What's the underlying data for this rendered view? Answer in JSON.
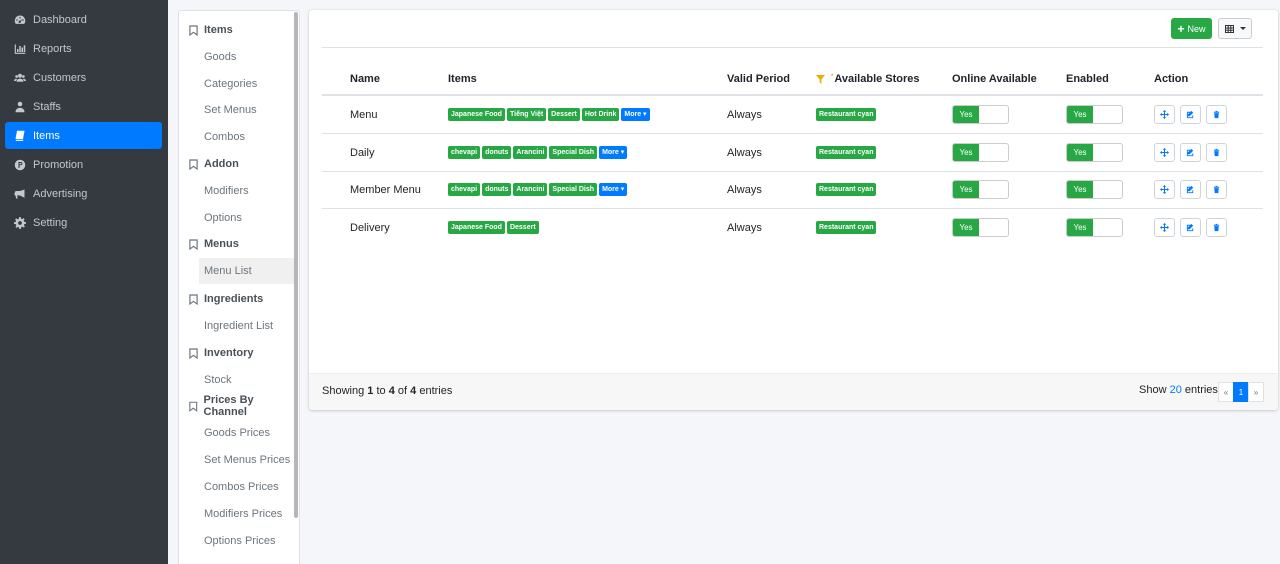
{
  "sidebar": {
    "items": [
      {
        "label": "Dashboard",
        "icon": "tachometer-icon"
      },
      {
        "label": "Reports",
        "icon": "bar-chart-icon"
      },
      {
        "label": "Customers",
        "icon": "users-icon"
      },
      {
        "label": "Staffs",
        "icon": "user-tie-icon"
      },
      {
        "label": "Items",
        "icon": "book-icon",
        "active": true
      },
      {
        "label": "Promotion",
        "icon": "product-hunt-icon"
      },
      {
        "label": "Advertising",
        "icon": "bullhorn-icon"
      },
      {
        "label": "Setting",
        "icon": "gear-icon"
      }
    ]
  },
  "subnav": {
    "items_head": "Items",
    "goods": "Goods",
    "categories": "Categories",
    "set_menus": "Set Menus",
    "combos": "Combos",
    "addon_head": "Addon",
    "modifiers": "Modifiers",
    "options": "Options",
    "menus_head": "Menus",
    "menu_list": "Menu List",
    "ingredients_head": "Ingredients",
    "ingredient_list": "Ingredient List",
    "inventory_head": "Inventory",
    "stock": "Stock",
    "prices_head": "Prices By Channel",
    "goods_prices": "Goods Prices",
    "set_menus_prices": "Set Menus Prices",
    "combos_prices": "Combos Prices",
    "modifiers_prices": "Modifiers Prices",
    "options_prices": "Options Prices"
  },
  "toolbar": {
    "new_label": "New",
    "new_color": "#28a745"
  },
  "table": {
    "headers": {
      "name": "Name",
      "items": "Items",
      "valid_period": "Valid Period",
      "available_stores": "Available Stores",
      "online_available": "Online Available",
      "enabled": "Enabled",
      "action": "Action"
    },
    "rows": [
      {
        "name": "Menu",
        "tags": [
          "Japanese Food",
          "Tiếng Việt",
          "Dessert",
          "Hot Drink"
        ],
        "more": "More",
        "valid": "Always",
        "store": "Restaurant cyan",
        "online": "Yes",
        "enabled": "Yes"
      },
      {
        "name": "Daily",
        "tags": [
          "chevapi",
          "donuts",
          "Arancini",
          "Special Dish"
        ],
        "more": "More",
        "valid": "Always",
        "store": "Restaurant cyan",
        "online": "Yes",
        "enabled": "Yes"
      },
      {
        "name": "Member Menu",
        "tags": [
          "chevapi",
          "donuts",
          "Arancini",
          "Special Dish"
        ],
        "more": "More",
        "valid": "Always",
        "store": "Restaurant cyan",
        "online": "Yes",
        "enabled": "Yes"
      },
      {
        "name": "Delivery",
        "tags": [
          "Japanese Food",
          "Dessert"
        ],
        "more": "",
        "valid": "Always",
        "store": "Restaurant cyan",
        "online": "Yes",
        "enabled": "Yes"
      }
    ]
  },
  "footer": {
    "showing": "Showing",
    "from": "1",
    "to_word": "to",
    "to": "4",
    "of_word": "of",
    "total": "4",
    "entries": "entries",
    "show_label": "Show",
    "page_size": "20",
    "show_entries": "entries",
    "prev": "«",
    "page": "1",
    "next": "»"
  },
  "colors": {
    "sidebar_bg": "#343a40",
    "active": "#007bff",
    "success": "#28a745"
  }
}
